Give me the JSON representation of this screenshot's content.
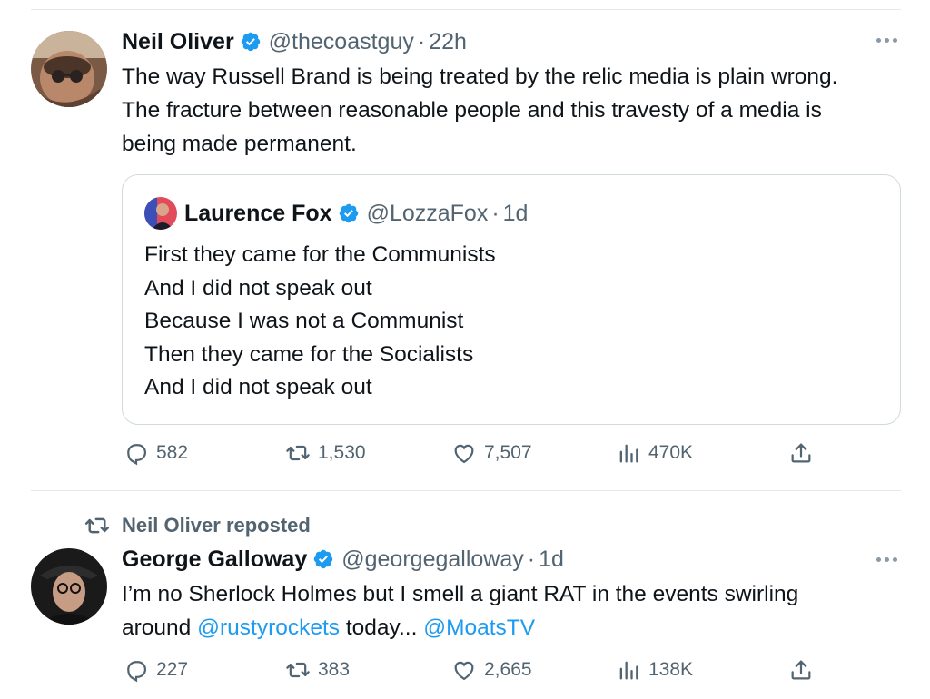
{
  "tweets": [
    {
      "author": {
        "name": "Neil Oliver",
        "handle": "@thecoastguy",
        "time": "22h",
        "verified": true
      },
      "text_lines": [
        "The way Russell Brand is being treated by the relic media is plain wrong.",
        "The fracture between reasonable people and this travesty of a media is",
        "being made permanent."
      ],
      "quote": {
        "author": {
          "name": "Laurence Fox",
          "handle": "@LozzaFox",
          "time": "1d",
          "verified": true
        },
        "text_lines": [
          "First they came for the Communists",
          "And I did not speak out",
          "Because I was not a Communist",
          "Then they came for the Socialists",
          "And I did not speak out"
        ]
      },
      "stats": {
        "replies": "582",
        "reposts": "1,530",
        "likes": "7,507",
        "views": "470K"
      }
    },
    {
      "repost_note": "Neil Oliver reposted",
      "author": {
        "name": "George Galloway",
        "handle": "@georgegalloway",
        "time": "1d",
        "verified": true
      },
      "text": {
        "line1": "I’m no Sherlock Holmes but I smell a giant RAT in the events swirling",
        "line2_prefix": "around ",
        "mention1": "@rustyrockets",
        "line2_middle": " today... ",
        "mention2": "@MoatsTV"
      },
      "stats": {
        "replies": "227",
        "reposts": "383",
        "likes": "2,665",
        "views": "138K"
      }
    }
  ],
  "separator_dot": "·",
  "icons": {
    "verified": "verified-badge-icon",
    "reply": "reply-icon",
    "repost": "repost-icon",
    "like": "heart-icon",
    "views": "views-icon",
    "share": "share-icon",
    "more": "more-icon"
  },
  "colors": {
    "link": "#1d9bf0",
    "verified": "#1d9bf0",
    "muted": "#536471",
    "text": "#0f1419"
  }
}
